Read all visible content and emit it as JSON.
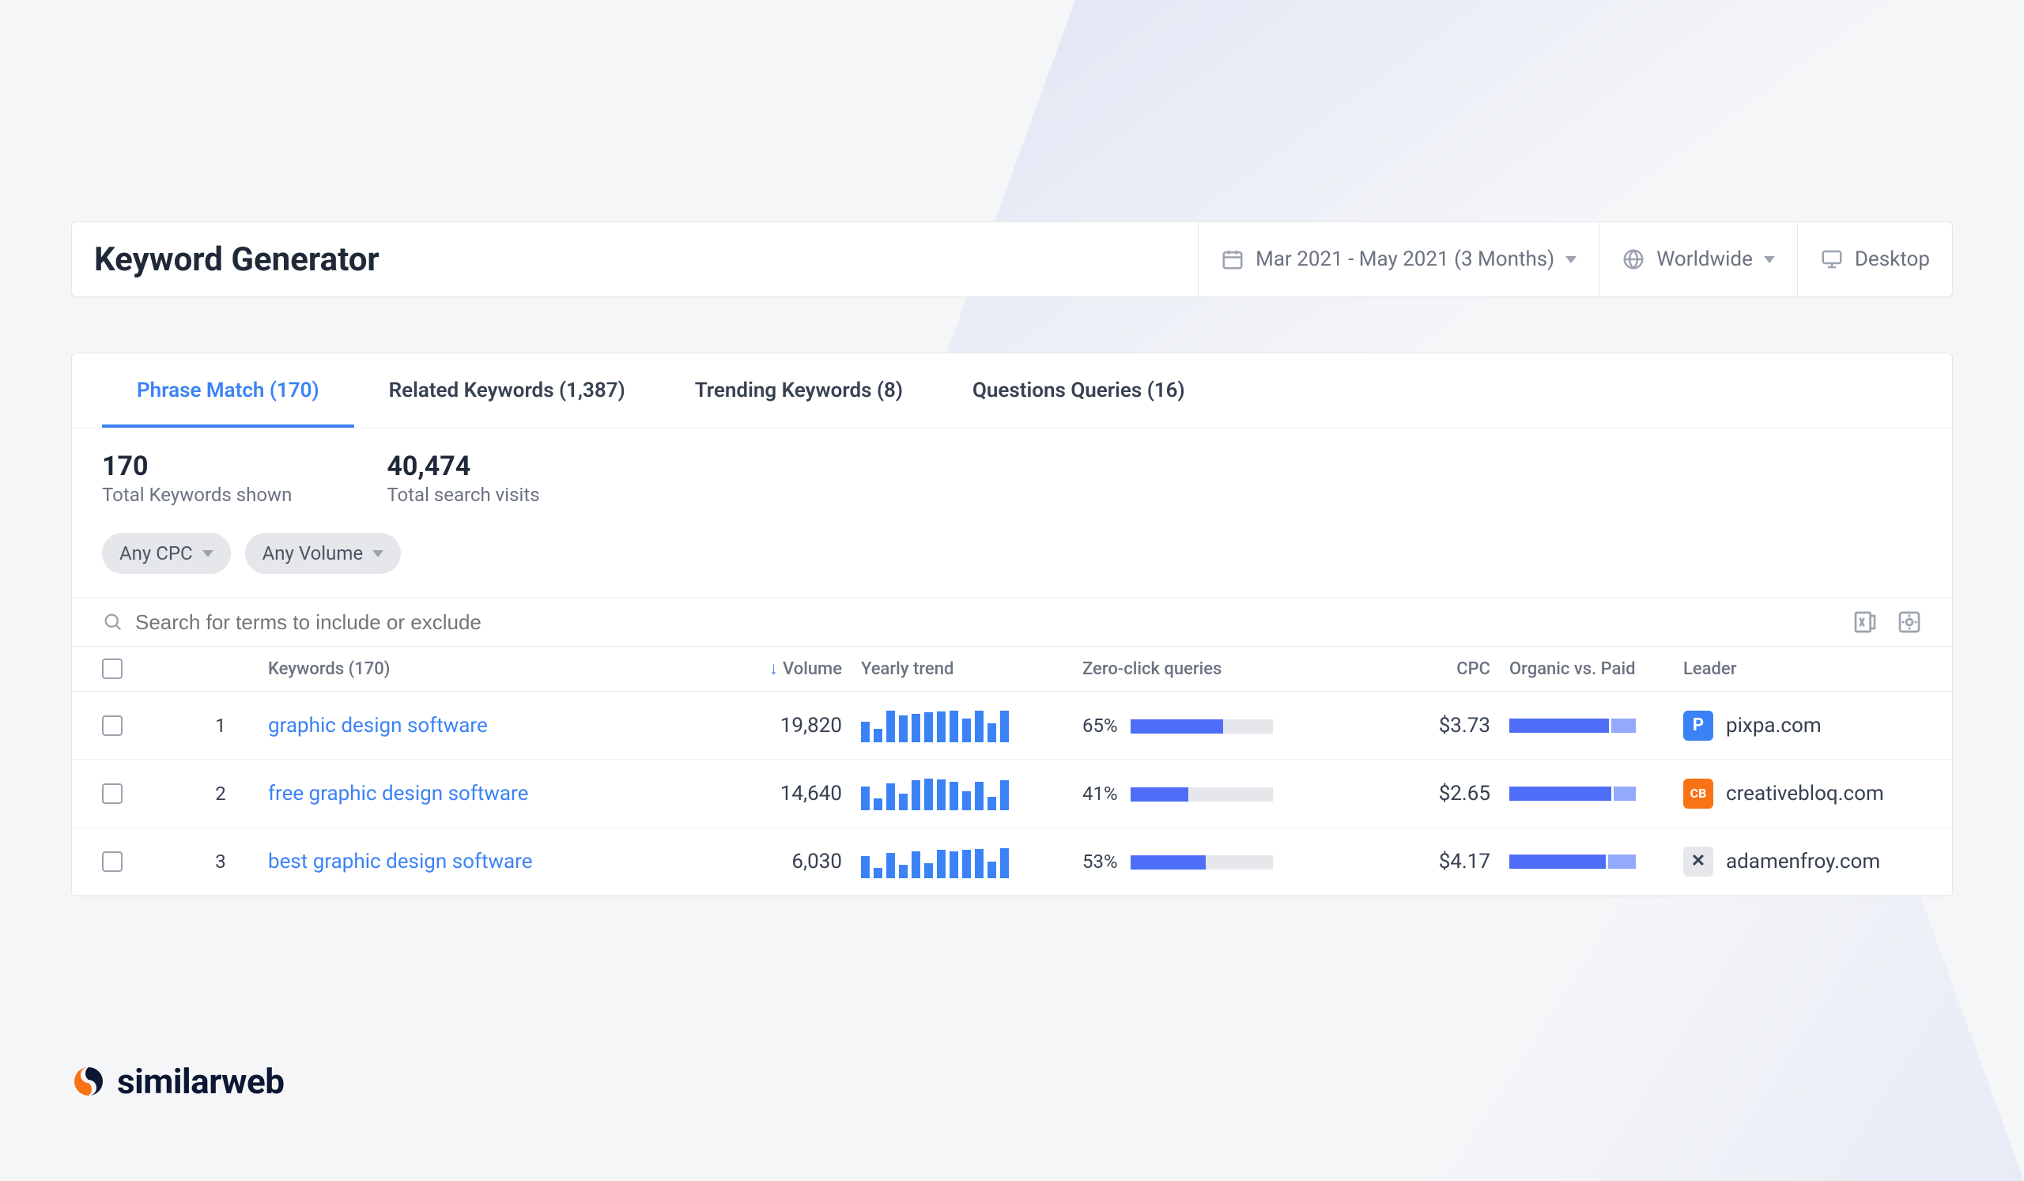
{
  "header": {
    "title": "Keyword Generator",
    "date_range": "Mar 2021 - May 2021 (3 Months)",
    "region": "Worldwide",
    "device": "Desktop"
  },
  "tabs": [
    {
      "label": "Phrase Match (170)",
      "active": true
    },
    {
      "label": "Related Keywords (1,387)",
      "active": false
    },
    {
      "label": "Trending Keywords (8)",
      "active": false
    },
    {
      "label": "Questions Queries (16)",
      "active": false
    }
  ],
  "stats": {
    "keywords_value": "170",
    "keywords_label": "Total Keywords shown",
    "visits_value": "40,474",
    "visits_label": "Total search visits"
  },
  "filters": {
    "cpc": "Any CPC",
    "volume": "Any Volume"
  },
  "search": {
    "placeholder": "Search for terms to include or exclude"
  },
  "columns": {
    "keywords": "Keywords (170)",
    "volume": "Volume",
    "trend": "Yearly trend",
    "zeroclick": "Zero-click queries",
    "cpc": "CPC",
    "ovp": "Organic vs. Paid",
    "leader": "Leader"
  },
  "rows": [
    {
      "index": "1",
      "keyword": "graphic design software",
      "volume": "19,820",
      "spark": [
        60,
        40,
        95,
        80,
        85,
        90,
        92,
        95,
        70,
        95,
        55,
        95
      ],
      "zeroclick_pct": "65%",
      "zeroclick_fill": 65,
      "cpc": "$3.73",
      "ovp_organic": 80,
      "ovp_paid": 20,
      "leader": "pixpa.com",
      "fav_bg": "#3b82f6",
      "fav_text": "P"
    },
    {
      "index": "2",
      "keyword": "free graphic design software",
      "volume": "14,640",
      "spark": [
        70,
        35,
        80,
        50,
        90,
        95,
        92,
        85,
        55,
        85,
        40,
        90
      ],
      "zeroclick_pct": "41%",
      "zeroclick_fill": 41,
      "cpc": "$2.65",
      "ovp_organic": 82,
      "ovp_paid": 18,
      "leader": "creativebloq.com",
      "fav_bg": "#f97316",
      "fav_text": "CB"
    },
    {
      "index": "3",
      "keyword": "best graphic design software",
      "volume": "6,030",
      "spark": [
        65,
        30,
        75,
        40,
        80,
        45,
        85,
        80,
        85,
        88,
        50,
        90
      ],
      "zeroclick_pct": "53%",
      "zeroclick_fill": 53,
      "cpc": "$4.17",
      "ovp_organic": 78,
      "ovp_paid": 22,
      "leader": "adamenfroy.com",
      "fav_bg": "#e5e7eb",
      "fav_text": "✕"
    }
  ],
  "brand": "similarweb"
}
